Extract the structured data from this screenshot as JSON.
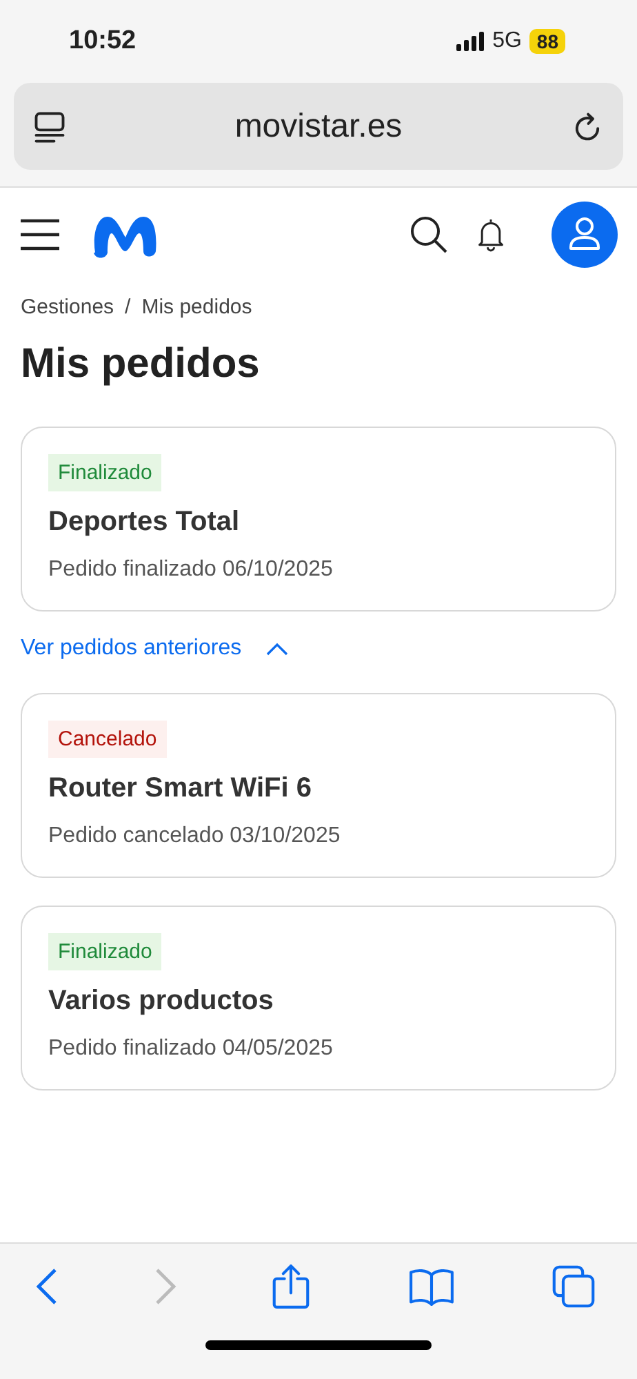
{
  "status_bar": {
    "time": "10:52",
    "network": "5G",
    "battery": "88"
  },
  "address_bar": {
    "url": "movistar.es"
  },
  "breadcrumb": [
    {
      "label": "Gestiones"
    },
    {
      "label": "/"
    },
    {
      "label": "Mis pedidos"
    }
  ],
  "page_title": "Mis pedidos",
  "orders": [
    {
      "status": "Finalizado",
      "kind": "done",
      "name": "Deportes Total",
      "detail": "Pedido finalizado 06/10/2025"
    }
  ],
  "previous_toggle": {
    "label": "Ver pedidos anteriores",
    "expanded": true
  },
  "previous_orders": [
    {
      "status": "Cancelado",
      "kind": "cancelled",
      "name": "Router Smart WiFi 6",
      "detail": "Pedido cancelado 03/10/2025"
    },
    {
      "status": "Finalizado",
      "kind": "done",
      "name": "Varios productos",
      "detail": "Pedido finalizado 04/05/2025"
    }
  ],
  "toolbar": {
    "back_disabled": false,
    "forward_disabled": true
  }
}
